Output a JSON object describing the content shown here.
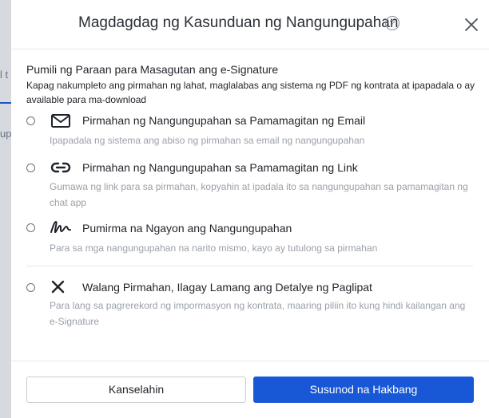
{
  "background": {
    "tab_fragment": "l t",
    "text_fragment": "up"
  },
  "modal": {
    "title": "Magdagdag ng Kasunduan ng Nangungupahan",
    "help_symbol": "?",
    "section_title": "Pumili ng Paraan para Masagutan ang e-Signature",
    "section_desc": "Kapag nakumpleto ang pirmahan ng lahat, maglalabas ang sistema ng PDF ng kontrata at ipapadala o ay available para ma-download",
    "options": [
      {
        "icon": "envelope-icon",
        "label": "Pirmahan ng Nangungupahan sa Pamamagitan ng Email",
        "desc": "Ipapadala ng sistema ang abiso ng pirmahan sa email ng nangungupahan"
      },
      {
        "icon": "link-icon",
        "label": "Pirmahan ng Nangungupahan sa Pamamagitan ng Link",
        "desc": "Gumawa ng link para sa pirmahan, kopyahin at ipadala ito sa nangungupahan sa pamamagitan ng chat app"
      },
      {
        "icon": "signature-icon",
        "label": "Pumirma na Ngayon ang Nangungupahan",
        "desc": "Para sa mga nangungupahan na narito mismo, kayo ay tutulong sa pirmahan"
      },
      {
        "icon": "x-mark-icon",
        "label": "Walang Pirmahan, Ilagay Lamang ang Detalye ng Paglipat",
        "desc": "Para lang sa pagrerekord ng impormasyon ng kontrata, maaring piliin ito kung hindi kailangan ang e-Signature"
      }
    ],
    "buttons": {
      "cancel": "Kanselahin",
      "next": "Susunod na Hakbang"
    }
  },
  "colors": {
    "primary": "#1857d6",
    "muted_text": "#9aa0a8",
    "backdrop": "#cfd3d8"
  }
}
